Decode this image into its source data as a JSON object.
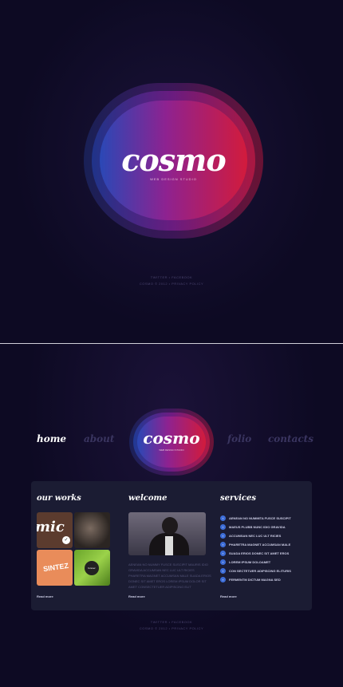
{
  "top": {
    "logo_word": "cosmo",
    "logo_tag": "WEB DESIGN STUDIO",
    "footer_line1": "TWITTER • FACEBOOK",
    "footer_line2": "COSMO © 2012 • PRIVACY POLICY"
  },
  "nav": {
    "home": "home",
    "about": "about",
    "folio": "folio",
    "contacts": "contacts"
  },
  "header_logo": {
    "word": "cosmo",
    "tag": "WEB DESIGN STUDIO"
  },
  "works": {
    "title": "our works",
    "thumb1_text": "mic",
    "thumb3_text": "SINTEZ",
    "thumb4_text": "forever",
    "read_more": "Read more"
  },
  "welcome": {
    "title": "welcome",
    "body": "AENEAN NO NUMMY FUSCE SUSCIPIT MAURIS IDIO GRAVIDA ACCUMSAN NEC LUC ULT RICIES PHARETRA MAGNET ACCUMSAN MALE SUADA ERIOS DONEC SIT AMET EROS LOREM IPSUM DOLOR SIT AMET CONSECTETUER ADIPISCING ELIT",
    "read_more": "Read more"
  },
  "services": {
    "title": "services",
    "items": [
      "AENEAN NO NUMMITA FUSCE SUSCIPIT",
      "MAEUS PLUBB NUNC IDIO GRAVIDA",
      "ACCUMSAN NEC LUC ULT RICIES",
      "PHARETRA MAGNET ACCUMSAN MALE",
      "SUADA ERIOS DONEC SIT AMET EROS",
      "LOREM IPSUM DOLOAMET",
      "CON SECTETUER ADIPISCING ELITURIS",
      "FERMENTM DICTUM MAGNA SED"
    ],
    "read_more": "Read more"
  },
  "bottom_footer": {
    "line1": "TWITTER • FACEBOOK",
    "line2": "COSMO © 2012 • PRIVACY POLICY"
  }
}
